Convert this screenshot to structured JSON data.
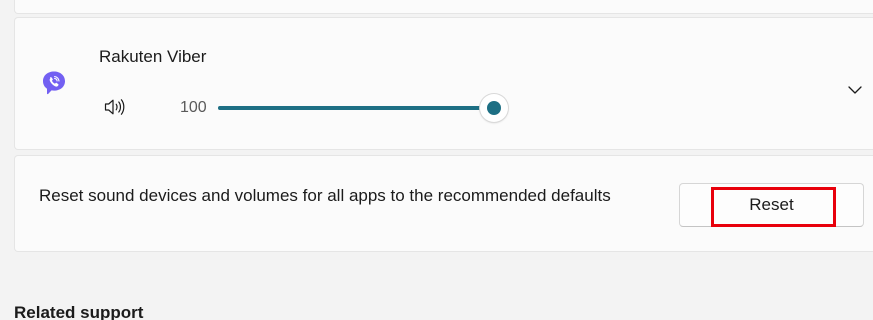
{
  "app_volume": {
    "app_name": "Rakuten Viber",
    "app_icon": "viber-icon",
    "speaker_icon": "speaker-icon",
    "volume_value": "100",
    "volume_percent": 100,
    "expand_icon": "chevron-down-icon"
  },
  "reset_section": {
    "description": "Reset sound devices and volumes for all apps to the recommended defaults",
    "button_label": "Reset"
  },
  "related_support": {
    "heading": "Related support"
  },
  "colors": {
    "accent": "#1d6f84",
    "viber_purple": "#7360f2",
    "highlight": "#e8000b"
  }
}
